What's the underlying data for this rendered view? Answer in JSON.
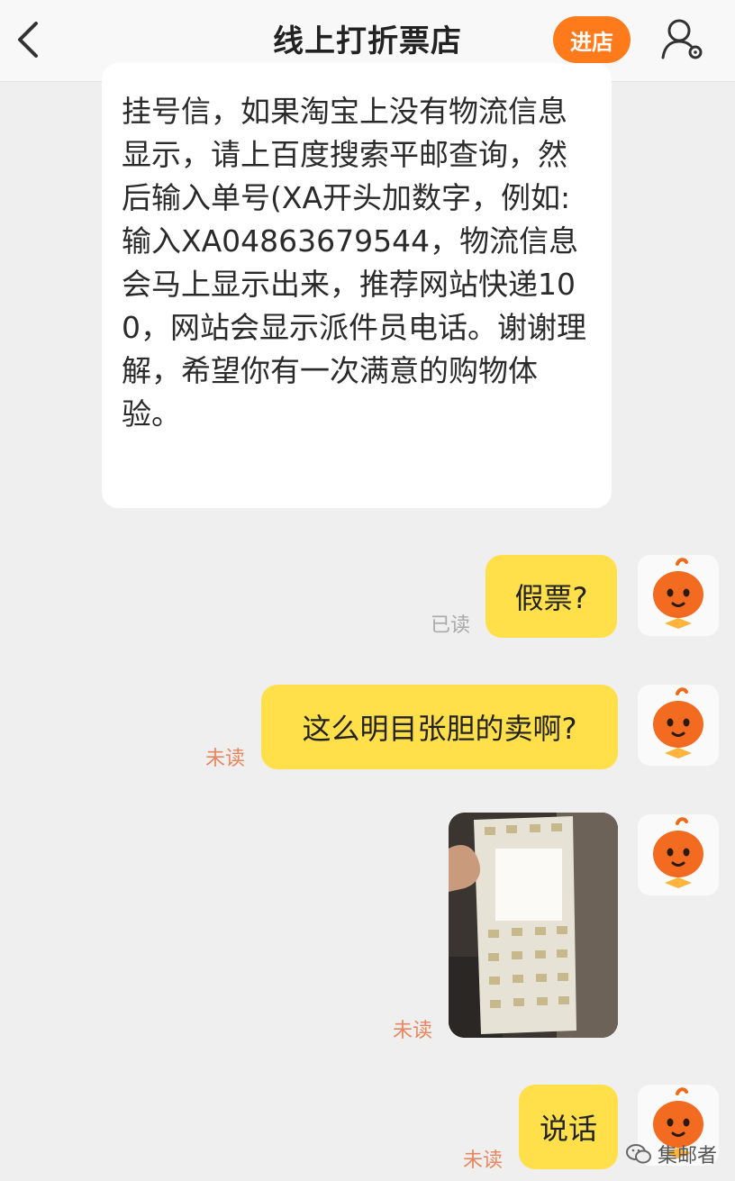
{
  "header": {
    "title": "线上打折票店",
    "enter_label": "进店"
  },
  "messages": {
    "incoming_text": "挂号信，如果淘宝上没有物流信息显示，请上百度搜索平邮查询，然后输入单号(XA开头加数字，例如:输入XA04863679544，物流信息会马上显示出来，推荐网站快递100，网站会显示派件员电话。谢谢理解，希望你有一次满意的购物体验。",
    "outgoing": [
      {
        "text": "假票?",
        "status": "已读"
      },
      {
        "text": "这么明目张胆的卖啊?",
        "status": "未读"
      },
      {
        "text": "",
        "status": "未读"
      },
      {
        "text": "说话",
        "status": "未读"
      }
    ]
  },
  "watermark": {
    "text": "集邮者"
  },
  "colors": {
    "accent": "#ff7a1a",
    "bubble": "#ffe04a",
    "unread": "#e8875f",
    "read": "#a9a9a9"
  },
  "icons": [
    "back-arrow-icon",
    "profile-settings-icon",
    "avatar-mascot-icon",
    "wechat-icon"
  ]
}
